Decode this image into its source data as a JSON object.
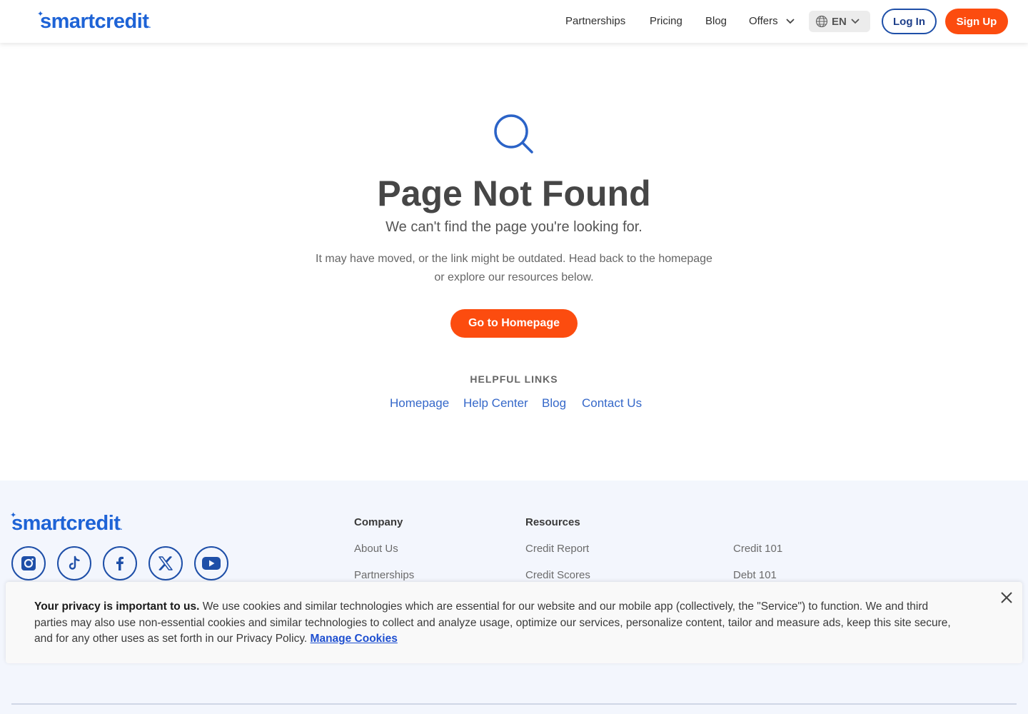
{
  "header": {
    "logo": {
      "text": "smartcredit",
      "mark": "."
    },
    "nav": [
      "Partnerships",
      "Pricing",
      "Blog",
      "Offers"
    ],
    "language": "EN",
    "login_label": "Log In",
    "signup_label": "Sign Up"
  },
  "main": {
    "title": "Page Not Found",
    "subtitle": "We can't find the page you're looking for.",
    "desc_line1": "It may have moved, or the link might be outdated. Head back to the homepage",
    "desc_line2": "or explore our resources below.",
    "cta_label": "Go to Homepage",
    "helpful_heading": "HELPFUL LINKS",
    "helpful_links": [
      "Homepage",
      "Help Center",
      "Blog",
      "Contact Us"
    ]
  },
  "footer": {
    "logo": {
      "text": "smartcredit",
      "mark": "."
    },
    "socials": [
      "instagram-icon",
      "tiktok-icon",
      "facebook-icon",
      "x-icon",
      "youtube-icon"
    ],
    "company_heading": "Company",
    "company_links": [
      "About Us",
      "Partnerships"
    ],
    "resources_heading": "Resources",
    "resources_links": [
      "Credit Report",
      "Credit Scores"
    ],
    "resources_links_2": [
      "Credit 101",
      "Debt 101"
    ]
  },
  "cookie_banner": {
    "lead": "Your privacy is important to us.",
    "body": " We use cookies and similar technologies which are essential for our website and our mobile app (collectively, the \"Service\") to function. We and third parties may also use non-essential cookies and similar technologies to collect and analyze usage, optimize our services, personalize content, tailor and measure ads, keep this site secure, and for any other uses as set forth in our Privacy Policy. ",
    "link": "Manage Cookies"
  },
  "colors": {
    "brand_blue": "#1e63d6",
    "accent_orange": "#fc4c0f",
    "link_blue": "#3568c9",
    "footer_bg": "#f3f6fd"
  }
}
